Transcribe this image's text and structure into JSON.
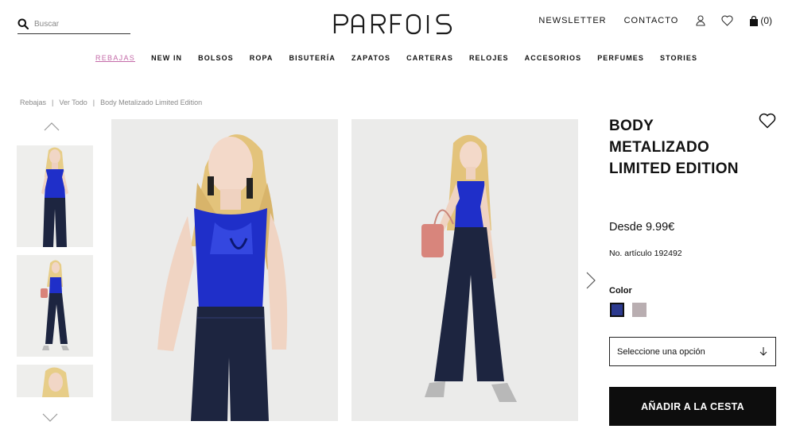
{
  "header": {
    "search_placeholder": "Buscar",
    "logo_text": "PARFOIS",
    "links": [
      "NEWSLETTER",
      "CONTACTO"
    ],
    "cart_count": "(0)"
  },
  "nav": {
    "items": [
      "REBAJAS",
      "NEW IN",
      "BOLSOS",
      "ROPA",
      "BISUTERÍA",
      "ZAPATOS",
      "CARTERAS",
      "RELOJES",
      "ACCESORIOS",
      "PERFUMES",
      "STORIES"
    ]
  },
  "breadcrumb": {
    "items": [
      "Rebajas",
      "Ver Todo",
      "Body Metalizado Limited Edition"
    ],
    "separator": "|"
  },
  "product": {
    "title": "BODY METALIZADO LIMITED EDITION",
    "price": "Desde 9.99€",
    "article": "No. artículo 192492",
    "color_label": "Color",
    "colors": [
      "#2c3a8f",
      "#b9aeb1"
    ],
    "size_placeholder": "Seleccione una opción",
    "add_to_cart": "AÑADIR A LA CESTA"
  },
  "colors": {
    "sale_accent": "#c46aa8",
    "cta_bg": "#0d0d0d",
    "body_blue": "#1f2fc9",
    "jeans": "#1d2540"
  },
  "icons": [
    "search-icon",
    "user-icon",
    "heart-icon",
    "bag-icon",
    "chevron-up-icon",
    "chevron-down-icon",
    "chevron-right-icon",
    "chevron-down-small-icon"
  ]
}
